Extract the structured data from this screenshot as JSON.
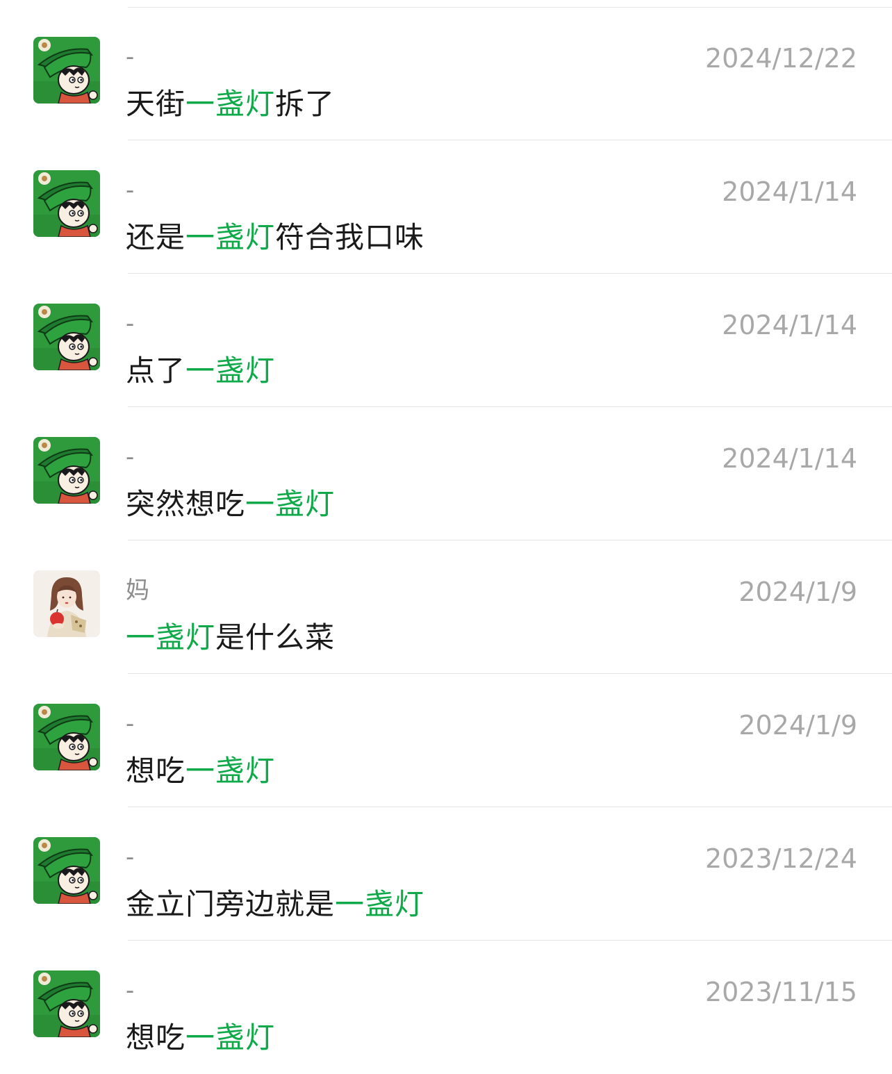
{
  "search": {
    "keyword": "一盏灯",
    "highlight_color": "#10a94a"
  },
  "results": [
    {
      "sender": "-",
      "date": "2024/12/22",
      "avatar_icon": "cartoon-boy-green-hat-avatar",
      "message": {
        "before": "天街",
        "match": "一盏灯",
        "after": "拆了"
      }
    },
    {
      "sender": "-",
      "date": "2024/1/14",
      "avatar_icon": "cartoon-boy-green-hat-avatar",
      "message": {
        "before": "还是",
        "match": "一盏灯",
        "after": "符合我口味"
      }
    },
    {
      "sender": "-",
      "date": "2024/1/14",
      "avatar_icon": "cartoon-boy-green-hat-avatar",
      "message": {
        "before": "点了",
        "match": "一盏灯",
        "after": ""
      }
    },
    {
      "sender": "-",
      "date": "2024/1/14",
      "avatar_icon": "cartoon-boy-green-hat-avatar",
      "message": {
        "before": "突然想吃",
        "match": "一盏灯",
        "after": ""
      }
    },
    {
      "sender": "妈",
      "date": "2024/1/9",
      "avatar_icon": "illustrated-girl-apple-avatar",
      "message": {
        "before": "",
        "match": "一盏灯",
        "after": "是什么菜"
      }
    },
    {
      "sender": "-",
      "date": "2024/1/9",
      "avatar_icon": "cartoon-boy-green-hat-avatar",
      "message": {
        "before": "想吃",
        "match": "一盏灯",
        "after": ""
      }
    },
    {
      "sender": "-",
      "date": "2023/12/24",
      "avatar_icon": "cartoon-boy-green-hat-avatar",
      "message": {
        "before": "金立门旁边就是",
        "match": "一盏灯",
        "after": ""
      }
    },
    {
      "sender": "-",
      "date": "2023/11/15",
      "avatar_icon": "cartoon-boy-green-hat-avatar",
      "message": {
        "before": "想吃",
        "match": "一盏灯",
        "after": ""
      }
    }
  ]
}
